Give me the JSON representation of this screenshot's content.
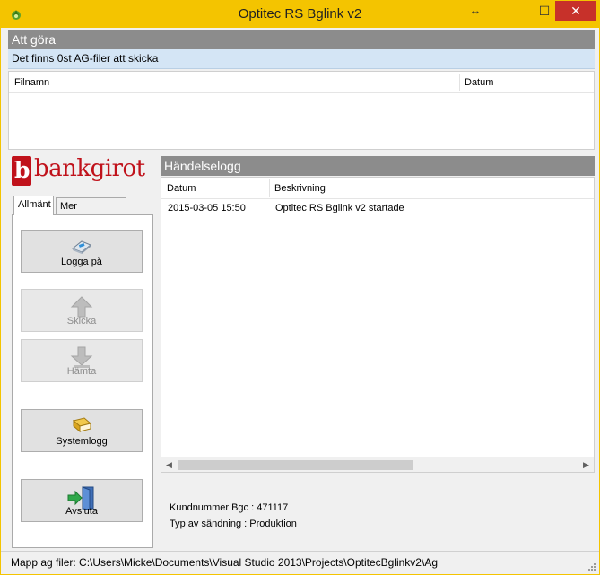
{
  "window": {
    "title": "Optitec RS Bglink v2",
    "resize_glyph": "↔",
    "minimize_glyph": "–",
    "maximize_glyph": "☐",
    "close_glyph": "✕"
  },
  "todo": {
    "header": "Att göra",
    "status": "Det finns 0st AG-filer att skicka",
    "columns": [
      "Filnamn",
      "Datum"
    ]
  },
  "logo": {
    "mark": "b",
    "text": "bankgirot",
    "color": "#c0121b"
  },
  "tabs": {
    "general": "Allmänt",
    "more_info": "Mer information"
  },
  "buttons": {
    "login": {
      "label": "Logga på",
      "icon": "keyboard-icon",
      "enabled": true
    },
    "send": {
      "label": "Skicka",
      "icon": "upload-arrow-icon",
      "enabled": false
    },
    "fetch": {
      "label": "Hämta",
      "icon": "download-arrow-icon",
      "enabled": false
    },
    "syslog": {
      "label": "Systemlogg",
      "icon": "book-icon",
      "enabled": true
    },
    "exit": {
      "label": "Avsluta",
      "icon": "exit-door-icon",
      "enabled": true
    }
  },
  "log": {
    "header": "Händelselogg",
    "columns": [
      "Datum",
      "Beskrivning"
    ],
    "rows": [
      {
        "date": "2015-03-05 15:50",
        "description": "Optitec RS Bglink v2 startade"
      }
    ]
  },
  "info": {
    "customer_number": "Kundnummer Bgc : 471117",
    "send_type": "Typ av sändning : Produktion"
  },
  "statusbar": {
    "text": "Mapp ag filer: C:\\Users\\Micke\\Documents\\Visual Studio 2013\\Projects\\OptitecBglinkv2\\Ag"
  },
  "colors": {
    "titlebar": "#f4c400",
    "panel_header": "#8c8c8c",
    "status_row": "#d4e5f5",
    "close": "#c7312a"
  }
}
